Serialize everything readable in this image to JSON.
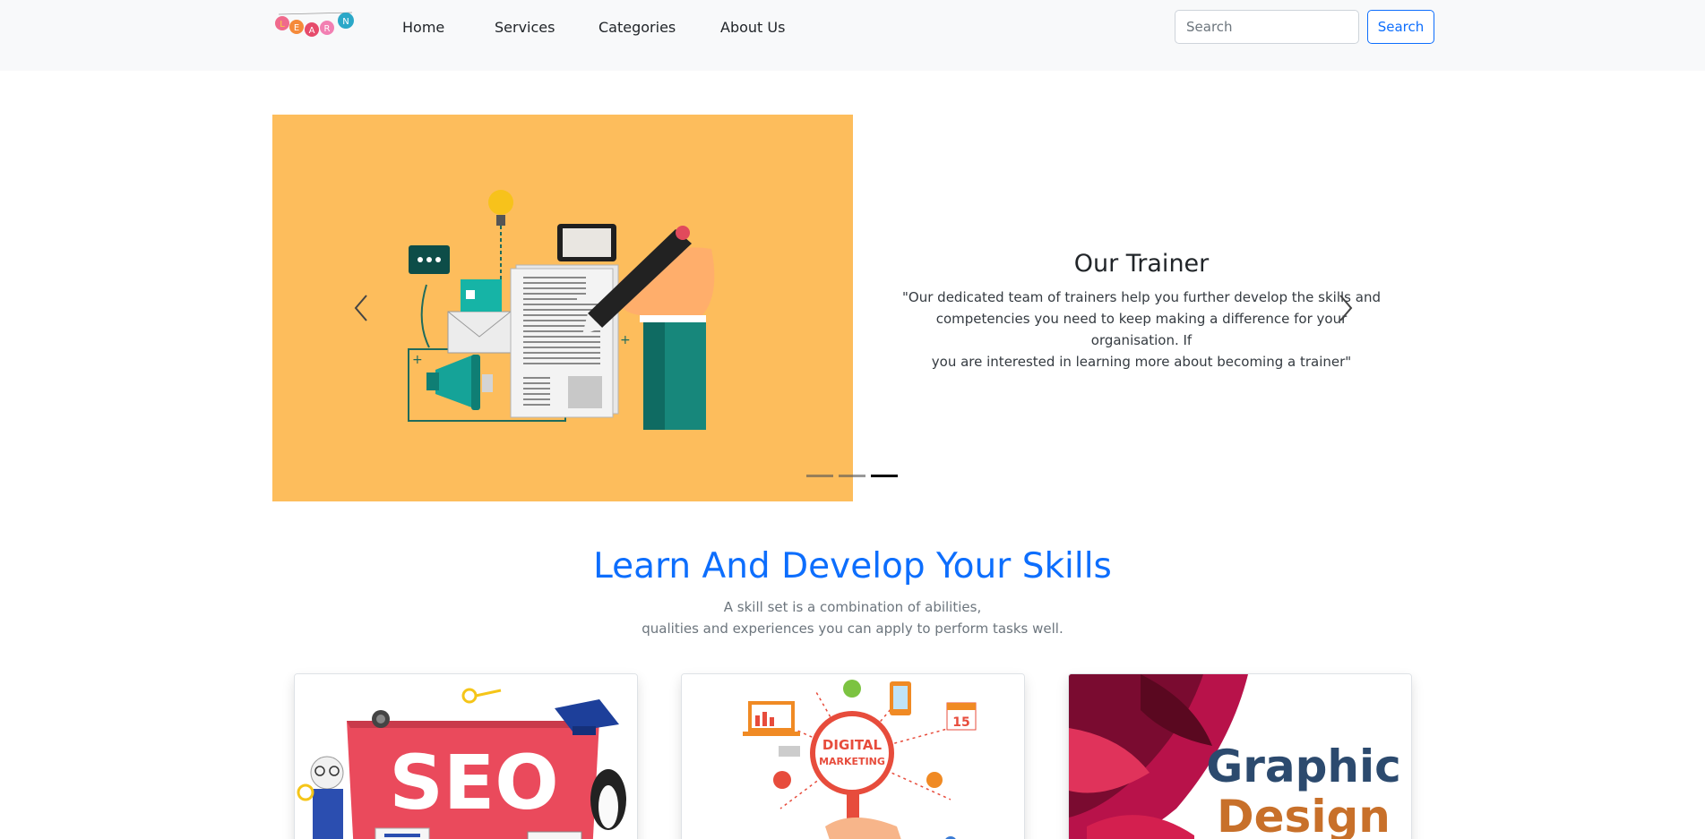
{
  "nav": {
    "links": [
      "Home",
      "Services",
      "Categories",
      "About Us"
    ],
    "search_placeholder": "Search",
    "search_button": "Search",
    "logo_letters": [
      "L",
      "E",
      "A",
      "R",
      "N"
    ]
  },
  "carousel": {
    "title": "Our Trainer",
    "text_line1": "\"Our dedicated team of trainers help you further develop the skills and",
    "text_line2": "competencies you need to keep making a difference for your organisation. If",
    "text_line3": "you are interested in learning more about becoming a trainer\"",
    "slide_count": 3,
    "active_index": 3,
    "background_color": "#fdbd5c"
  },
  "skills": {
    "heading": "Learn And Develop Your Skills",
    "sub_line1": "A skill set is a combination of abilities,",
    "sub_line2": "qualities and experiences you can apply to perform tasks well."
  },
  "cards": [
    {
      "title": "SEO"
    },
    {
      "title_line1": "DIGITAL",
      "title_line2": "MARKETING",
      "date": "15"
    },
    {
      "title_line1": "Graphic",
      "title_line2": "Design"
    }
  ],
  "colors": {
    "accent": "#0d6efd",
    "navbar_bg": "#f8f9fa"
  }
}
